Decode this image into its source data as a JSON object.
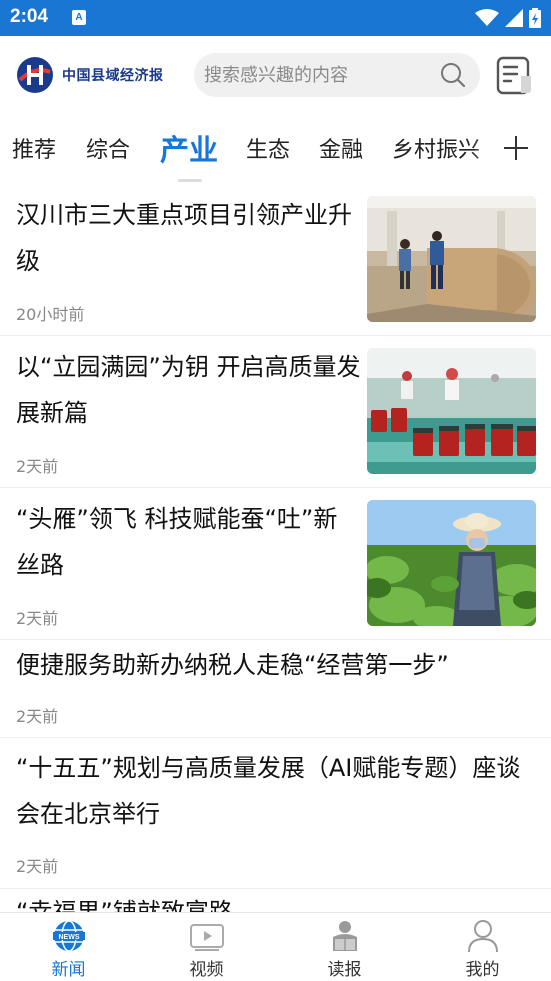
{
  "status_bar": {
    "time": "2:04",
    "notification_glyph": "A",
    "bg_color": "#1976d2"
  },
  "header": {
    "logo_text": "中国县域经济报",
    "search": {
      "placeholder": "搜索感兴趣的内容",
      "icon": "search-icon"
    },
    "paper_icon": "newspaper-icon"
  },
  "tabs": [
    {
      "label": "推荐",
      "active": false
    },
    {
      "label": "综合",
      "active": false
    },
    {
      "label": "产业",
      "active": true
    },
    {
      "label": "生态",
      "active": false
    },
    {
      "label": "金融",
      "active": false
    },
    {
      "label": "乡村振兴",
      "active": false
    }
  ],
  "tabs_more_icon": "plus-icon",
  "news": [
    {
      "title": "汉川市三大重点项目引领产业升级",
      "time": "20小时前",
      "has_image": true,
      "image": "factory-paper-roll-photo"
    },
    {
      "title": "以“立园满园”为钥  开启高质量发展新篇",
      "time": "2天前",
      "has_image": true,
      "image": "food-production-line-photo"
    },
    {
      "title": "“头雁”领飞 科技赋能蚕“吐”新丝路",
      "time": "2天前",
      "has_image": true,
      "image": "mulberry-farmer-photo"
    },
    {
      "title": "便捷服务助新办纳税人走稳“经营第一步”",
      "time": "2天前",
      "has_image": false
    },
    {
      "title": "“十五五”规划与高质量发展（AI赋能专题）座谈会在北京举行",
      "time": "2天前",
      "has_image": false
    },
    {
      "title": "“幸福果”铺就致富路",
      "time": "",
      "has_image": false
    }
  ],
  "bottom_nav": [
    {
      "label": "新闻",
      "icon": "news-globe-icon",
      "active": true
    },
    {
      "label": "视频",
      "icon": "video-icon",
      "active": false
    },
    {
      "label": "读报",
      "icon": "read-paper-icon",
      "active": false
    },
    {
      "label": "我的",
      "icon": "profile-icon",
      "active": false
    }
  ],
  "colors": {
    "accent": "#1677d4",
    "text": "#111111",
    "muted": "#888888"
  }
}
